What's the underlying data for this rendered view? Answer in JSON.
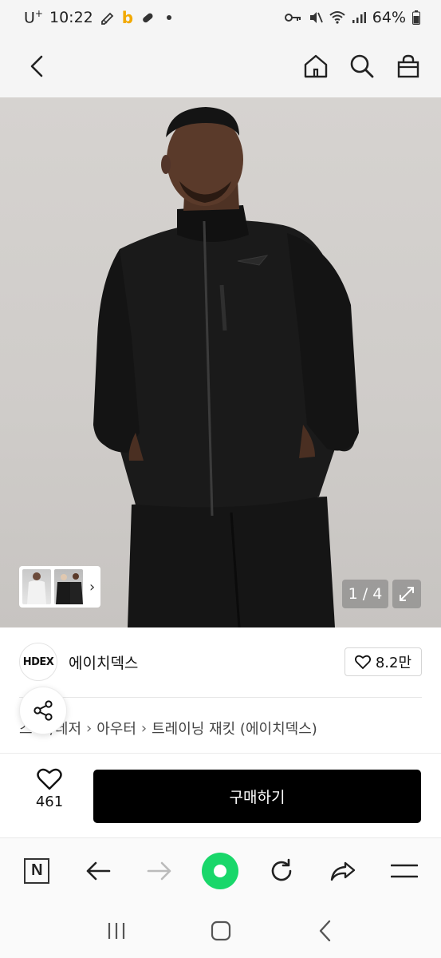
{
  "status_bar": {
    "carrier": "U",
    "carrier_sup": "+",
    "time": "10:22",
    "battery": "64%"
  },
  "top_nav": {
    "back_icon": "chevron-left-icon",
    "home_icon": "home-icon",
    "search_icon": "search-icon",
    "bag_icon": "shopping-bag-icon"
  },
  "hero": {
    "counter": "1 / 4",
    "expand_icon": "expand-icon"
  },
  "brand": {
    "logo_text": "HDEX",
    "name": "에이치덱스",
    "like_count": "8.2만"
  },
  "breadcrumb": {
    "items": [
      "스포츠/레저",
      "아우터",
      "트레이닝 재킷 (에이치덱스)"
    ],
    "visible_first": "스  츠/레저"
  },
  "purchase": {
    "wish_count": "461",
    "buy_label": "구매하기"
  },
  "colors": {
    "buy_button": "#000000",
    "green_home": "#19d76a"
  }
}
